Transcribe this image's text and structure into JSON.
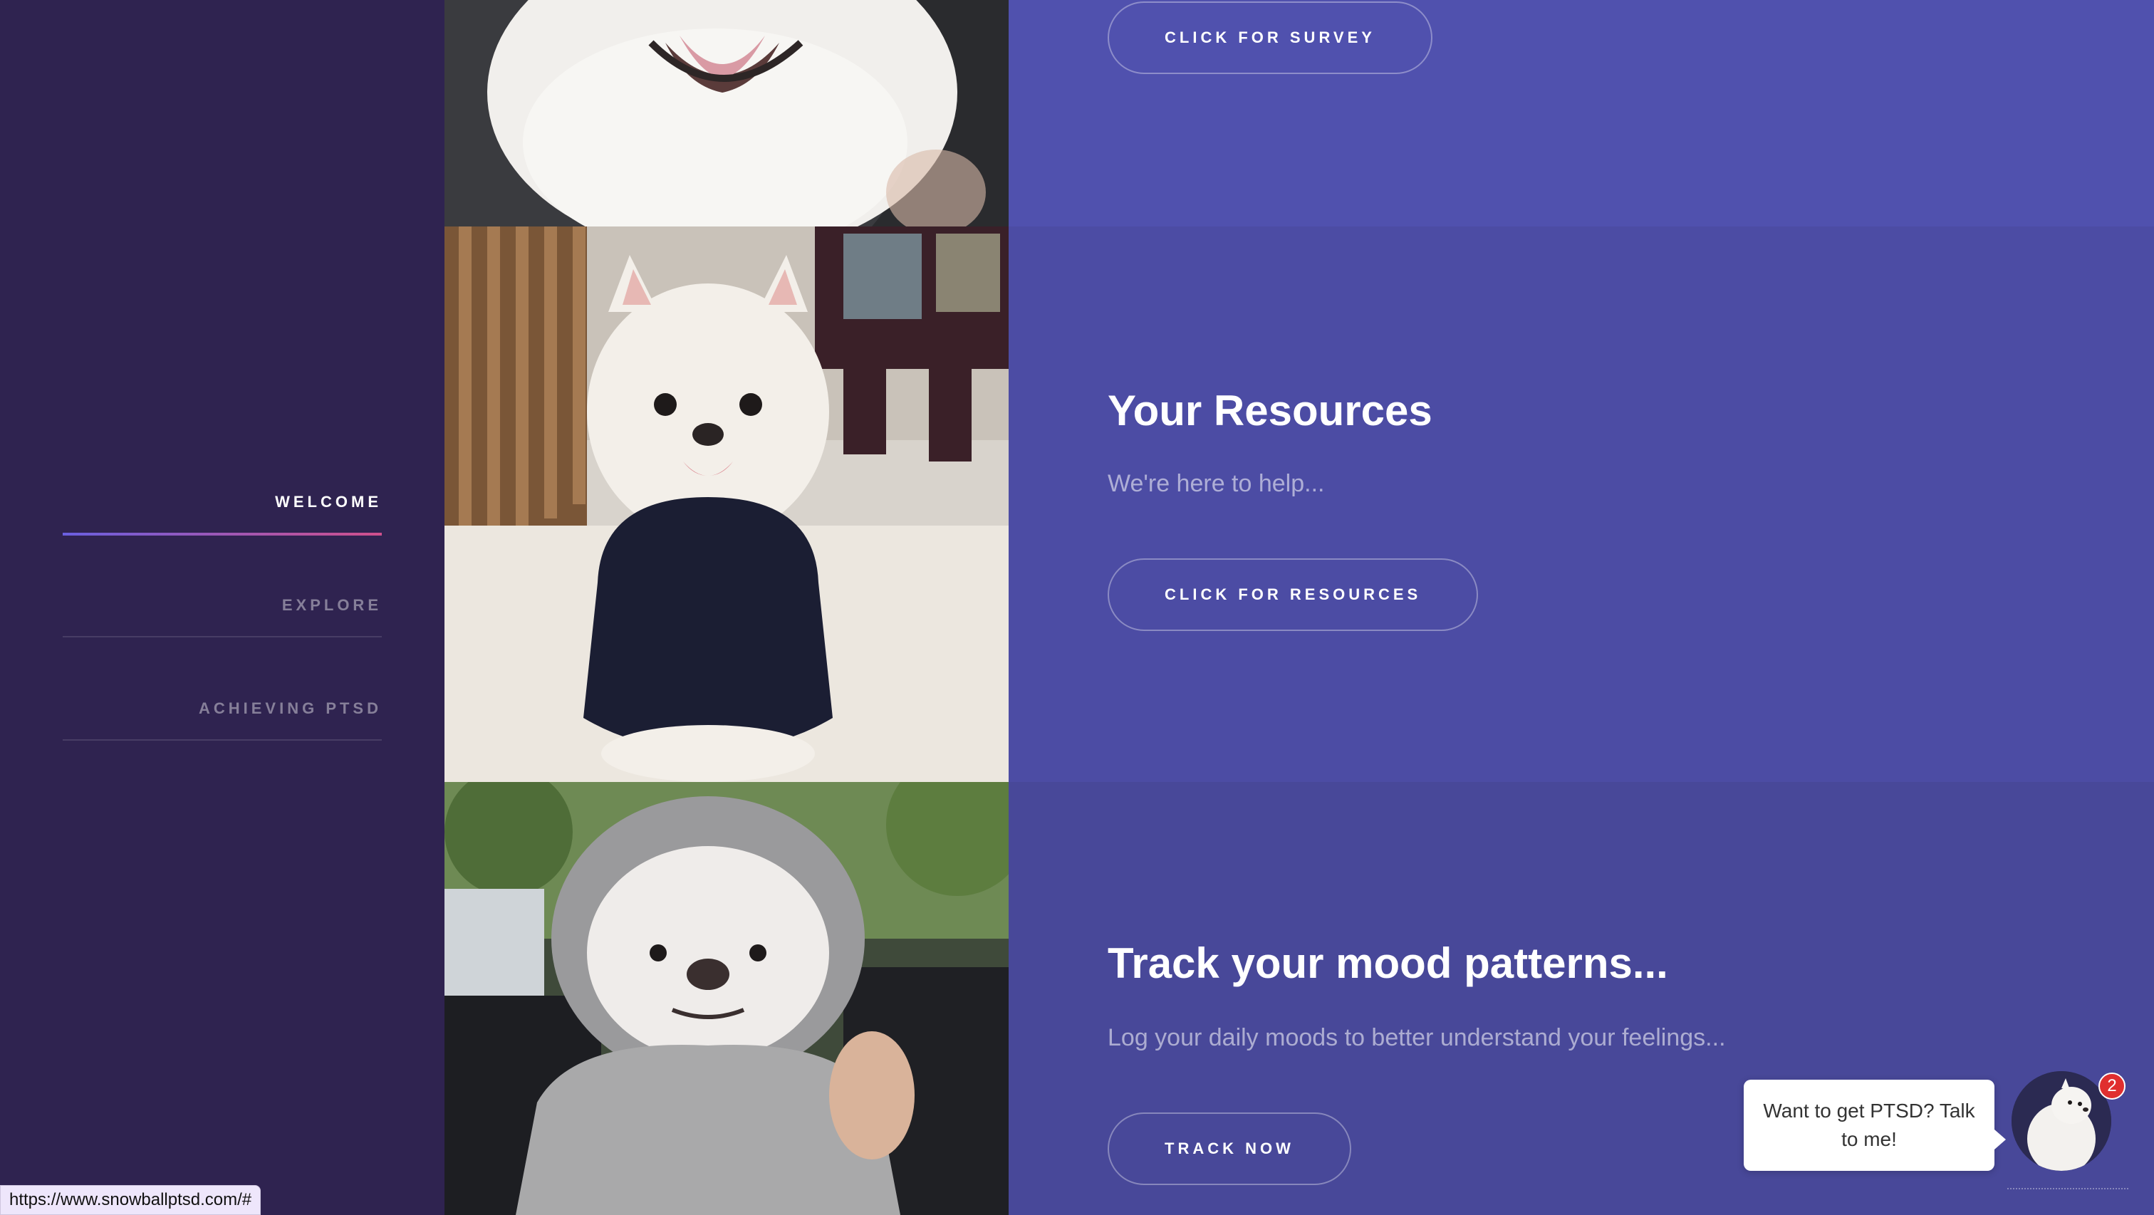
{
  "nav": {
    "items": [
      {
        "label": "WELCOME"
      },
      {
        "label": "EXPLORE"
      },
      {
        "label": "ACHIEVING PTSD"
      }
    ]
  },
  "sections": [
    {
      "button_label": "CLICK FOR SURVEY"
    },
    {
      "title": "Your Resources",
      "subtitle": "We're here to help...",
      "button_label": "CLICK FOR RESOURCES"
    },
    {
      "title": "Track your mood patterns...",
      "subtitle": "Log your daily moods to better understand your feelings...",
      "button_label": "TRACK NOW"
    }
  ],
  "chat": {
    "message": "Want to get PTSD? Talk to me!",
    "badge_count": "2"
  },
  "status_url": "https://www.snowballptsd.com/#",
  "colors": {
    "sidebar": "#2f2350",
    "panel_1": "#5051ae",
    "panel_2": "#4c4ca4",
    "panel_3": "#484899",
    "badge": "#e02f2f"
  }
}
